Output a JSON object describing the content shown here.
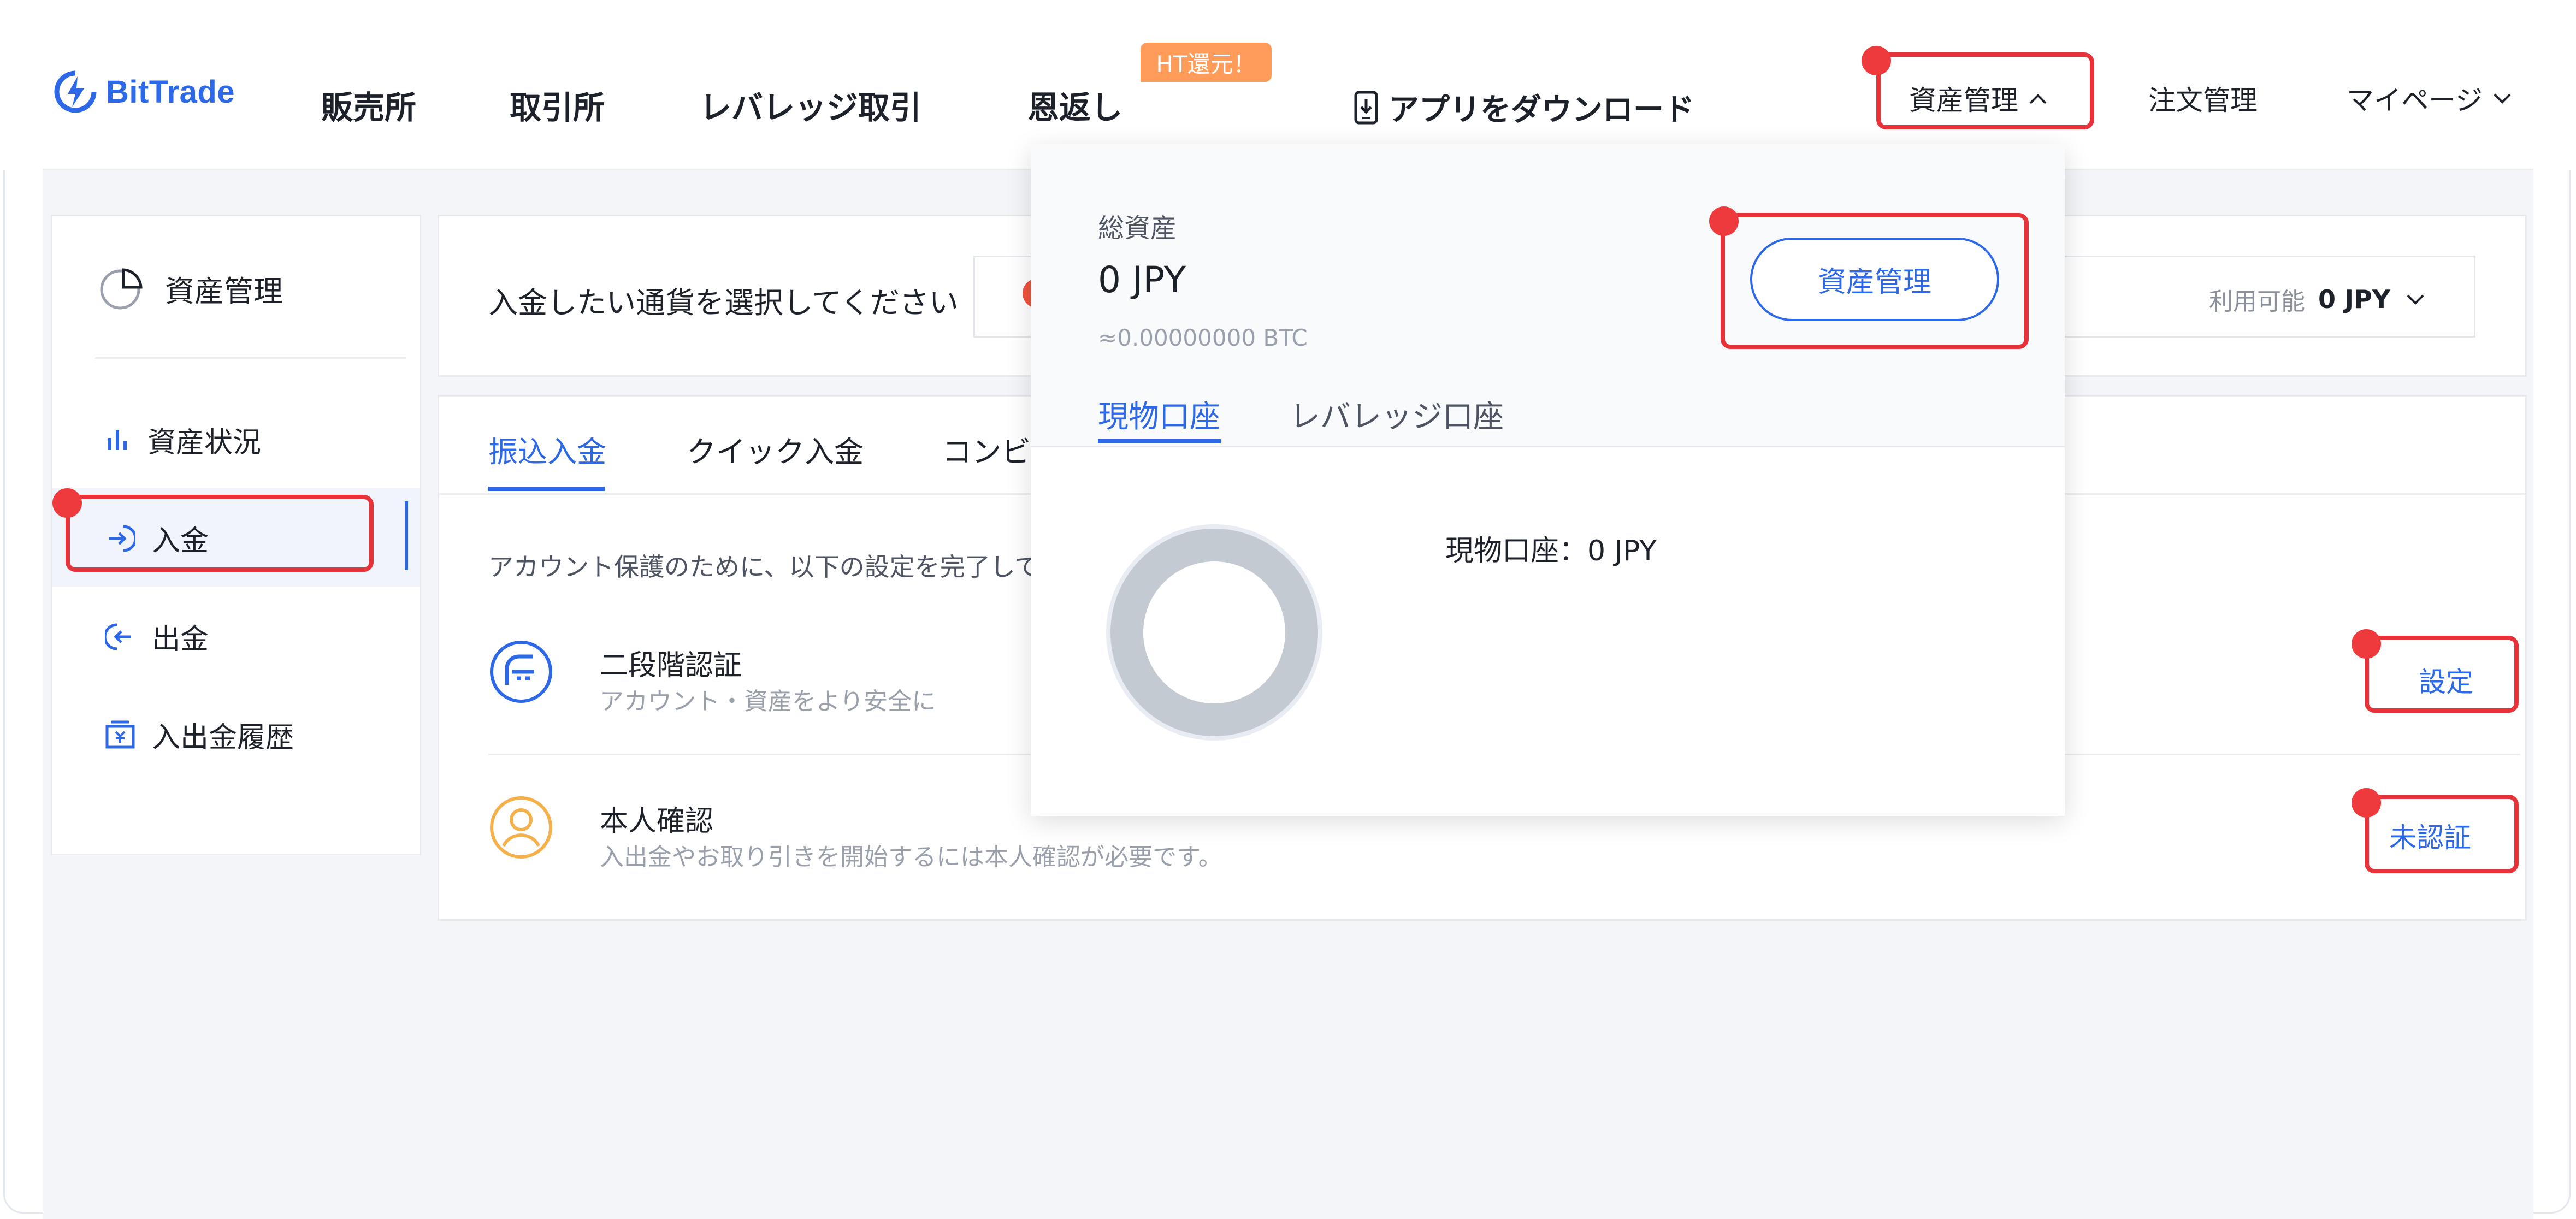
{
  "brand": {
    "name": "BitTrade"
  },
  "nav": {
    "items": [
      "販売所",
      "取引所",
      "レバレッジ取引",
      "恩返し"
    ],
    "badge": "HT還元！",
    "download": "アプリをダウンロード",
    "assets": "資産管理",
    "orders": "注文管理",
    "mypage": "マイページ"
  },
  "sidebar": {
    "title": "資産管理",
    "items": [
      {
        "label": "資産状況",
        "icon": "bar-chart-icon"
      },
      {
        "label": "入金",
        "icon": "deposit-arrow-icon"
      },
      {
        "label": "出金",
        "icon": "withdraw-arrow-icon"
      },
      {
        "label": "入出金履歴",
        "icon": "history-icon"
      }
    ]
  },
  "select": {
    "label": "入金したい通貨を選択してください",
    "available_label": "利用可能",
    "available_value": "0 JPY"
  },
  "main": {
    "tabs": [
      "振込入金",
      "クイック入金",
      "コンビ"
    ],
    "notice": "アカウント保護のために、以下の設定を完了して",
    "rows": [
      {
        "title": "二段階認証",
        "subtitle": "アカウント・資産をより安全に",
        "action": "設定"
      },
      {
        "title": "本人確認",
        "subtitle": "入出金やお取り引きを開始するには本人確認が必要です。",
        "action": "未認証"
      }
    ]
  },
  "dropdown": {
    "total_label": "総資産",
    "total_value": "0 JPY",
    "btc_value": "≈0.00000000 BTC",
    "button": "資産管理",
    "tabs": [
      "現物口座",
      "レバレッジ口座"
    ],
    "spot_line": "現物口座：0 JPY"
  },
  "colors": {
    "accent": "#2c68e8",
    "annotation": "#e8323a",
    "badge": "#ff9c5a"
  }
}
